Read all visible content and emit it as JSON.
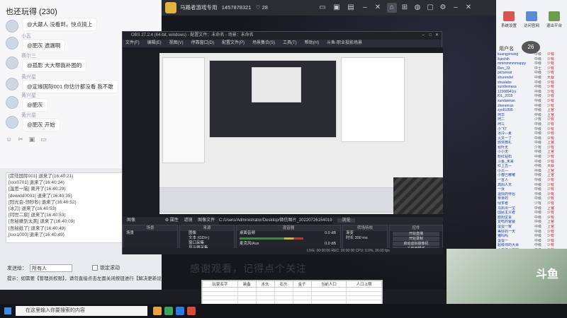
{
  "chat": {
    "title": "也还玩得 (230)",
    "messages": [
      {
        "name": "",
        "text": "@大颠人 没看到，快点搞上"
      },
      {
        "name": "小瓦",
        "text": "@肥灰 遗漏啊"
      },
      {
        "name": "赛尔三",
        "text": "@孤影 大大帮我补图的"
      },
      {
        "name": "黄兴星",
        "text": "@定缘国际001 你估计都没看 我不敢"
      },
      {
        "name": "黄兴星",
        "text": "@肥灰"
      },
      {
        "name": "黄兴星",
        "text": "@肥灰 开始"
      }
    ],
    "toolbar_icons": [
      "smile-icon",
      "scissors-icon",
      "image-icon",
      "folder-icon"
    ]
  },
  "log": {
    "lines": [
      "[定陆国际001] 退来了(16:40:21)",
      "[xxx0701]  退来了(16:40:34)",
      "[温思一脑] 离开了(16:40:29)",
      "[dewidd0001] 退来了(16:40:35)",
      "[阳光会-领秒秒] 退来了(16:40:52)",
      "[冰刀] 退来了(16:40:53)",
      "[同世二宸] 退来了(16:40:53)",
      "[吾秘嫩到太美] 退来了(16:40:09)",
      "[吾秘纸了] 退来了(16:40:49)",
      "[xxx1000] 退来了(16:40:49)"
    ]
  },
  "room_selector": {
    "label": "发送给：",
    "value": "所有人"
  },
  "lock_check": {
    "label": "锁定滚动"
  },
  "tip_line": "提示：如需要【管理员权限】，请勿直接点击左面关闭按钮进行【解决更新设置】后再打开",
  "topbar": {
    "tab_label": "马路者游戏专用",
    "room_id": "1457878321",
    "count": "28"
  },
  "obs": {
    "title": "OBS 27.2.4 (64-bit, windows) - 配置文件：未命名 - 场景：未命名",
    "menu": [
      "文件(F)",
      "编辑(E)",
      "视图(V)",
      "停靠窗口(D)",
      "配置文件(P)",
      "场景集合(S)",
      "工具(T)",
      "帮助(H)",
      "斗鱼-职业投影场景"
    ],
    "midbar": {
      "label": "图像",
      "prop1": "属性",
      "prop2": "滤镜",
      "path_label": "图像文件",
      "path": "C:/Users/Administrator/Desktop/微信图片_20220726154019.jpg",
      "browse": "浏览"
    },
    "docks": {
      "scenes": {
        "title": "场景",
        "items": [
          "场景"
        ]
      },
      "sources": {
        "title": "来源",
        "items": [
          "图像",
          "文本 (GDI+)",
          "窗口采集",
          "显示器采集"
        ]
      },
      "mixer": {
        "title": "混音器",
        "ch1": "桌面音频",
        "ch2": "麦克风/Aux",
        "db": "0.0 dB"
      },
      "transitions": {
        "title": "转场特效",
        "type": "渐变",
        "duration_label": "时长",
        "duration": "300 ms"
      },
      "controls": {
        "title": "控件",
        "buttons": [
          "开始直播",
          "开始录制",
          "启动虚拟摄像机",
          "工作室模式",
          "设置",
          "退出"
        ]
      }
    },
    "status": "LIVE: 00:00:00   REC: 00:00:00   CPU: 0.9%, 30.00 fps"
  },
  "right": {
    "icons": [
      {
        "label": "系统设置",
        "color": "#d9534f"
      },
      {
        "label": "访问官网",
        "color": "#5b8ad6"
      },
      {
        "label": "退出平台",
        "color": "#6d9d4a"
      }
    ],
    "viewer_count": "26",
    "viewer_header": "用户名",
    "viewers": [
      [
        "kuangyinsing",
        "中级",
        "少有"
      ],
      [
        "livechih",
        "中级",
        "少有"
      ],
      [
        "mmmmmmmappy",
        "中级",
        "少有"
      ],
      [
        "Ren_33",
        "中士",
        "少有"
      ],
      [
        "pictureair",
        "中级",
        "少有"
      ],
      [
        "shurendel",
        "中级",
        "大蔡"
      ],
      [
        "shuslabs",
        "中级",
        "少有"
      ],
      [
        "xundixmasa",
        "中级",
        "少有"
      ],
      [
        "12308941rs",
        "中级",
        "少有"
      ],
      [
        "KIL_2019",
        "中级",
        "少有"
      ],
      [
        "xundaniran",
        "中级",
        "少有"
      ],
      [
        "zherenran",
        "中级",
        "少有"
      ],
      [
        "zyn51895",
        "中级",
        "上官"
      ],
      [
        "阿华",
        "中级",
        "上官"
      ],
      [
        "阿二",
        "少有",
        "少有"
      ],
      [
        "阿三",
        "中级",
        "少有"
      ],
      [
        "小飞7",
        "中级",
        "少有"
      ],
      [
        "冰冷—夏",
        "中级",
        "少有"
      ],
      [
        "火又一了",
        "中级",
        "少有"
      ],
      [
        "颁奖典礼",
        "中级",
        "上官"
      ],
      [
        "秋叶无",
        "少有",
        "少有"
      ],
      [
        "小小无",
        "中级",
        "上官"
      ],
      [
        "粉红钻石",
        "中级",
        "少有"
      ],
      [
        "斗鱼_未来",
        "中级",
        "少有"
      ],
      [
        "红上五—",
        "中级",
        "大蔡"
      ],
      [
        "小贝—",
        "中级",
        "上官"
      ],
      [
        "小春巴嘟嘟",
        "中级",
        "上官"
      ],
      [
        "一言人",
        "中级",
        "少有"
      ],
      [
        "高阳人天",
        "中级",
        "少有"
      ],
      [
        "一汝",
        "中级",
        "少有"
      ],
      [
        "温情的伴侣",
        "中级",
        "少有"
      ],
      [
        "亲亲的",
        "中级",
        "少有"
      ],
      [
        "绿茶者",
        "少有",
        "少有"
      ],
      [
        "马凯出一宝",
        "中级",
        "上官"
      ],
      [
        "国民主义者",
        "中级",
        "少有"
      ],
      [
        "欧阳宝贵",
        "中级",
        "少有"
      ],
      [
        "爱吃的爸爸",
        "中级",
        "上官"
      ],
      [
        "蛋蛋一家",
        "中级",
        "上官"
      ],
      [
        "美好的一天",
        "中级",
        "少有"
      ],
      [
        "猪吗吗",
        "中级",
        "少有"
      ],
      [
        "蛋蛋一",
        "中级",
        "少有"
      ],
      [
        "超级帅的大哥",
        "中级",
        "少有"
      ],
      [
        "小王子小狐狸",
        "中级",
        "少有"
      ],
      [
        "安然无恙",
        "中级",
        "少有"
      ],
      [
        "大号",
        "中级",
        "少有"
      ],
      [
        "彩虹",
        "中级",
        "少有"
      ],
      [
        "快乐男生",
        "中级",
        "少有"
      ],
      [
        "小小",
        "中级",
        "少有"
      ],
      [
        "呵呵",
        "中级",
        "少有"
      ]
    ]
  },
  "webcam": {
    "logo": "斗鱼",
    "id": "7501439"
  },
  "subtitle": "感谢观看，记得点个关注",
  "table": {
    "headers": [
      "玩家名字",
      "装备",
      "木头",
      "石头",
      "金子",
      "当前人口",
      "人口上限"
    ]
  },
  "taskbar": {
    "search_placeholder": "在这里输入你要搜索的内容"
  }
}
